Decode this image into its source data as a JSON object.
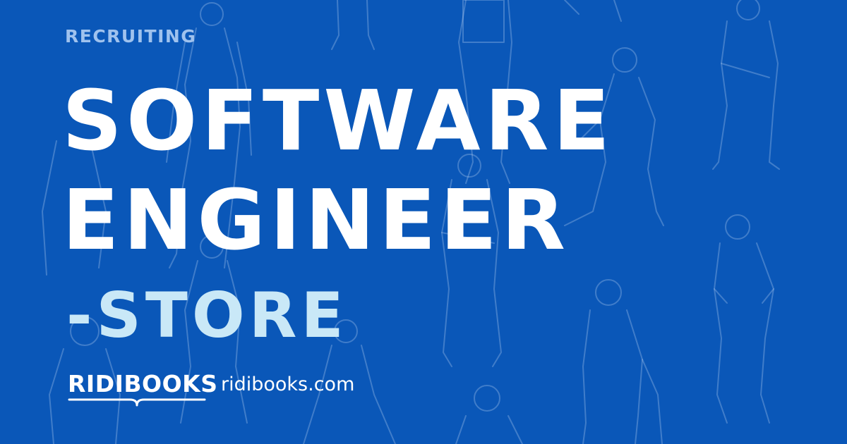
{
  "header": {
    "eyebrow": "RECRUITING"
  },
  "headline": {
    "line1": "SOFTWARE",
    "line2": "ENGINEER",
    "line3": "-STORE"
  },
  "brand": {
    "logo_text": "RIDIBOOKS",
    "url": "ridibooks.com"
  },
  "colors": {
    "background": "#0a57b8",
    "title": "#ffffff",
    "subtitle": "#c9e8f7",
    "eyebrow": "#9fc2ee"
  }
}
